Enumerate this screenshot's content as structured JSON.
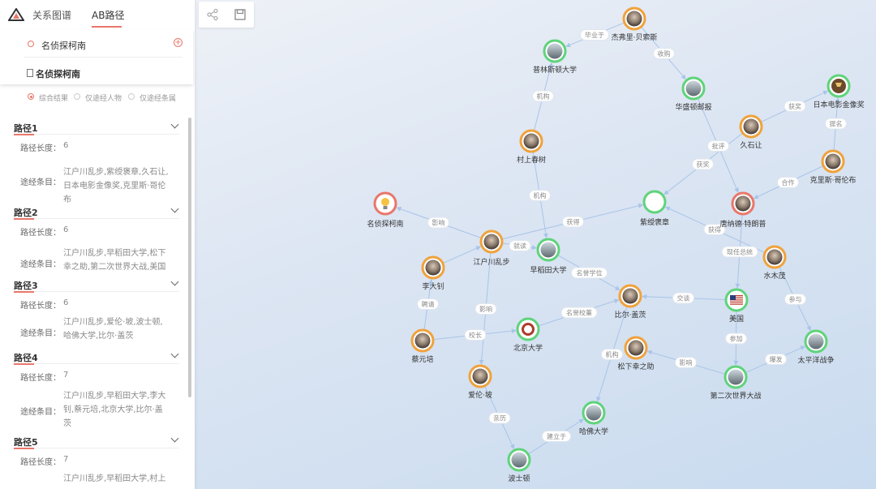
{
  "tabs": [
    "关系图谱",
    "AB路径"
  ],
  "search": {
    "entity": "名侦探柯南",
    "target": "名侦探柯南"
  },
  "modes": [
    "综合结果",
    "仅途经人物",
    "仅途经条属"
  ],
  "paths": [
    {
      "title": "路径1",
      "length_key": "路径长度：",
      "length": "6",
      "via_key": "途经条目：",
      "via_lines": [
        "江户川乱步,紫绶褒章,久石让,",
        "日本电影金像奖,克里斯·哥伦",
        "布"
      ]
    },
    {
      "title": "路径2",
      "length_key": "路径长度：",
      "length": "6",
      "via_key": "途经条目：",
      "via_lines": [
        "江户川乱步,早稻田大学,松下",
        "幸之助,第二次世界大战,美国"
      ]
    },
    {
      "title": "路径3",
      "length_key": "路径长度：",
      "length": "6",
      "via_key": "途经条目：",
      "via_lines": [
        "江户川乱步,爱伦·坡,波士顿,",
        "哈佛大学,比尔·盖茨"
      ]
    },
    {
      "title": "路径4",
      "length_key": "路径长度：",
      "length": "7",
      "via_key": "途经条目：",
      "via_lines": [
        "江户川乱步,早稻田大学,李大",
        "钊,蔡元培,北京大学,比尔·盖",
        "茨"
      ]
    },
    {
      "title": "路径5",
      "length_key": "路径长度：",
      "length": "7",
      "via_key": "途经条目：",
      "via_lines": [
        "江户川乱步,早稻田大学,村上"
      ]
    }
  ],
  "toolbar": {
    "share_icon": "share-icon",
    "save_icon": "save-icon"
  },
  "colors": {
    "accent": "#e9776b",
    "orange": "#f0a23c",
    "green": "#5fd37b",
    "edge": "#a9c4e8"
  },
  "graph": {
    "nodes": [
      {
        "id": "jiexi",
        "label": "杰弗里·贝索斯",
        "ring": "orange",
        "icon": "person-portrait-icon"
      },
      {
        "id": "prince",
        "label": "普林斯顿大学",
        "ring": "green",
        "icon": "building-icon"
      },
      {
        "id": "wapo",
        "label": "华盛顿邮报",
        "ring": "green",
        "icon": "building-icon"
      },
      {
        "id": "jpfilm",
        "label": "日本电影金像奖",
        "ring": "green",
        "icon": "trophy-icon"
      },
      {
        "id": "jiushi",
        "label": "久石让",
        "ring": "orange",
        "icon": "person-portrait-icon"
      },
      {
        "id": "murakami",
        "label": "村上春树",
        "ring": "orange",
        "icon": "person-portrait-icon"
      },
      {
        "id": "chris",
        "label": "克里斯·哥伦布",
        "ring": "orange",
        "icon": "person-portrait-icon"
      },
      {
        "id": "conan",
        "label": "名侦探柯南",
        "ring": "red",
        "icon": "lightbulb-icon"
      },
      {
        "id": "zishou",
        "label": "紫绶褒章",
        "ring": "green",
        "icon": "medal-icon"
      },
      {
        "id": "trump",
        "label": "唐纳德·特朗普",
        "ring": "red",
        "icon": "person-portrait-icon"
      },
      {
        "id": "edogawa",
        "label": "江户川乱步",
        "ring": "orange",
        "icon": "person-portrait-icon"
      },
      {
        "id": "waseda",
        "label": "早稻田大学",
        "ring": "green",
        "icon": "building-icon"
      },
      {
        "id": "lidazhao",
        "label": "李大钊",
        "ring": "orange",
        "icon": "person-portrait-icon"
      },
      {
        "id": "mizuki",
        "label": "水木茂",
        "ring": "orange",
        "icon": "person-portrait-icon"
      },
      {
        "id": "usa",
        "label": "美国",
        "ring": "green",
        "icon": "flag-icon"
      },
      {
        "id": "gates",
        "label": "比尔·盖茨",
        "ring": "orange",
        "icon": "person-portrait-icon"
      },
      {
        "id": "caiyuanpei",
        "label": "蔡元培",
        "ring": "orange",
        "icon": "person-portrait-icon"
      },
      {
        "id": "pku",
        "label": "北京大学",
        "ring": "green",
        "icon": "emblem-icon"
      },
      {
        "id": "matsushita",
        "label": "松下幸之助",
        "ring": "orange",
        "icon": "person-portrait-icon"
      },
      {
        "id": "pacific",
        "label": "太平洋战争",
        "ring": "green",
        "icon": "scene-icon"
      },
      {
        "id": "poe",
        "label": "爱伦·坡",
        "ring": "orange",
        "icon": "person-portrait-icon"
      },
      {
        "id": "ww2",
        "label": "第二次世界大战",
        "ring": "green",
        "icon": "scene-icon"
      },
      {
        "id": "harvard",
        "label": "哈佛大学",
        "ring": "green",
        "icon": "building-icon"
      },
      {
        "id": "boston",
        "label": "波士顿",
        "ring": "green",
        "icon": "scene-icon"
      }
    ],
    "edges": [
      {
        "from": "jiexi",
        "to": "prince",
        "label": "毕业于"
      },
      {
        "from": "jiexi",
        "to": "wapo",
        "label": "收购"
      },
      {
        "from": "murakami",
        "to": "prince",
        "label": "机构"
      },
      {
        "from": "murakami",
        "to": "waseda",
        "label": "机构"
      },
      {
        "from": "jiushi",
        "to": "jpfilm",
        "label": "获奖"
      },
      {
        "from": "jiushi",
        "to": "zishou",
        "label": "获奖"
      },
      {
        "from": "chris",
        "to": "jpfilm",
        "label": "提名"
      },
      {
        "from": "chris",
        "to": "trump",
        "label": "合作"
      },
      {
        "from": "wapo",
        "to": "trump",
        "label": "批评"
      },
      {
        "from": "edogawa",
        "to": "conan",
        "label": "影响"
      },
      {
        "from": "edogawa",
        "to": "zishou",
        "label": "获得"
      },
      {
        "from": "edogawa",
        "to": "waseda",
        "label": "就读"
      },
      {
        "from": "lidazhao",
        "to": "edogawa",
        "label": ""
      },
      {
        "from": "edogawa",
        "to": "poe",
        "label": "影响"
      },
      {
        "from": "mizuki",
        "to": "zishou",
        "label": "获得"
      },
      {
        "from": "mizuki",
        "to": "pacific",
        "label": "参与"
      },
      {
        "from": "trump",
        "to": "usa",
        "label": "现任总统"
      },
      {
        "from": "usa",
        "to": "gates",
        "label": "交谈"
      },
      {
        "from": "usa",
        "to": "ww2",
        "label": "参加"
      },
      {
        "from": "ww2",
        "to": "pacific",
        "label": "爆发"
      },
      {
        "from": "ww2",
        "to": "matsushita",
        "label": "影响"
      },
      {
        "from": "waseda",
        "to": "gates",
        "label": "名誉学位"
      },
      {
        "from": "pku",
        "to": "gates",
        "label": "名誉校董"
      },
      {
        "from": "caiyuanpei",
        "to": "lidazhao",
        "label": "聘请"
      },
      {
        "from": "caiyuanpei",
        "to": "pku",
        "label": "校长"
      },
      {
        "from": "gates",
        "to": "harvard",
        "label": "机构"
      },
      {
        "from": "boston",
        "to": "harvard",
        "label": "建立于"
      },
      {
        "from": "poe",
        "to": "boston",
        "label": "亲历"
      }
    ]
  }
}
